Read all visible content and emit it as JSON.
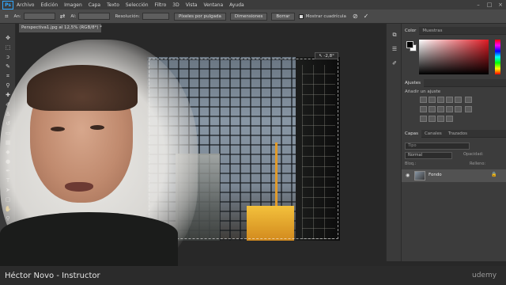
{
  "menubar": {
    "logo": "Ps",
    "items": [
      "Archivo",
      "Edición",
      "Imagen",
      "Capa",
      "Texto",
      "Selección",
      "Filtro",
      "3D",
      "Vista",
      "Ventana",
      "Ayuda"
    ],
    "window_controls": [
      "–",
      "□",
      "×"
    ]
  },
  "options_bar": {
    "width_label": "An:",
    "height_label": "Al:",
    "resolution_label": "Resolución:",
    "resolution_unit": "Píxeles por pulgada",
    "dimensions_button": "Dimensiones",
    "clear_button": "Borrar",
    "grid_label": "Mostrar cuadrícula"
  },
  "document": {
    "tab_title": "Perspectiva1.jpg al 12,5% (RGB/8*) *",
    "badge": "↖ -2,8°"
  },
  "panels": {
    "color_tabs": [
      "Color",
      "Muestras"
    ],
    "adjustments_tab": "Ajustes",
    "adjustments_title": "Añadir un ajuste",
    "layers_tabs": [
      "Capas",
      "Canales",
      "Trazados"
    ],
    "layers_search": "Tipo",
    "blend_mode": "Normal",
    "opacity_label": "Opacidad:",
    "lock_label": "Bloq.:",
    "fill_label": "Relleno:",
    "layer_name": "Fondo"
  },
  "colors": {
    "foreground": "#000000",
    "background": "#ffffff",
    "accent": "#31a8ff"
  },
  "caption": {
    "text": "Héctor Novo - Instructor",
    "brand": "udemy"
  }
}
